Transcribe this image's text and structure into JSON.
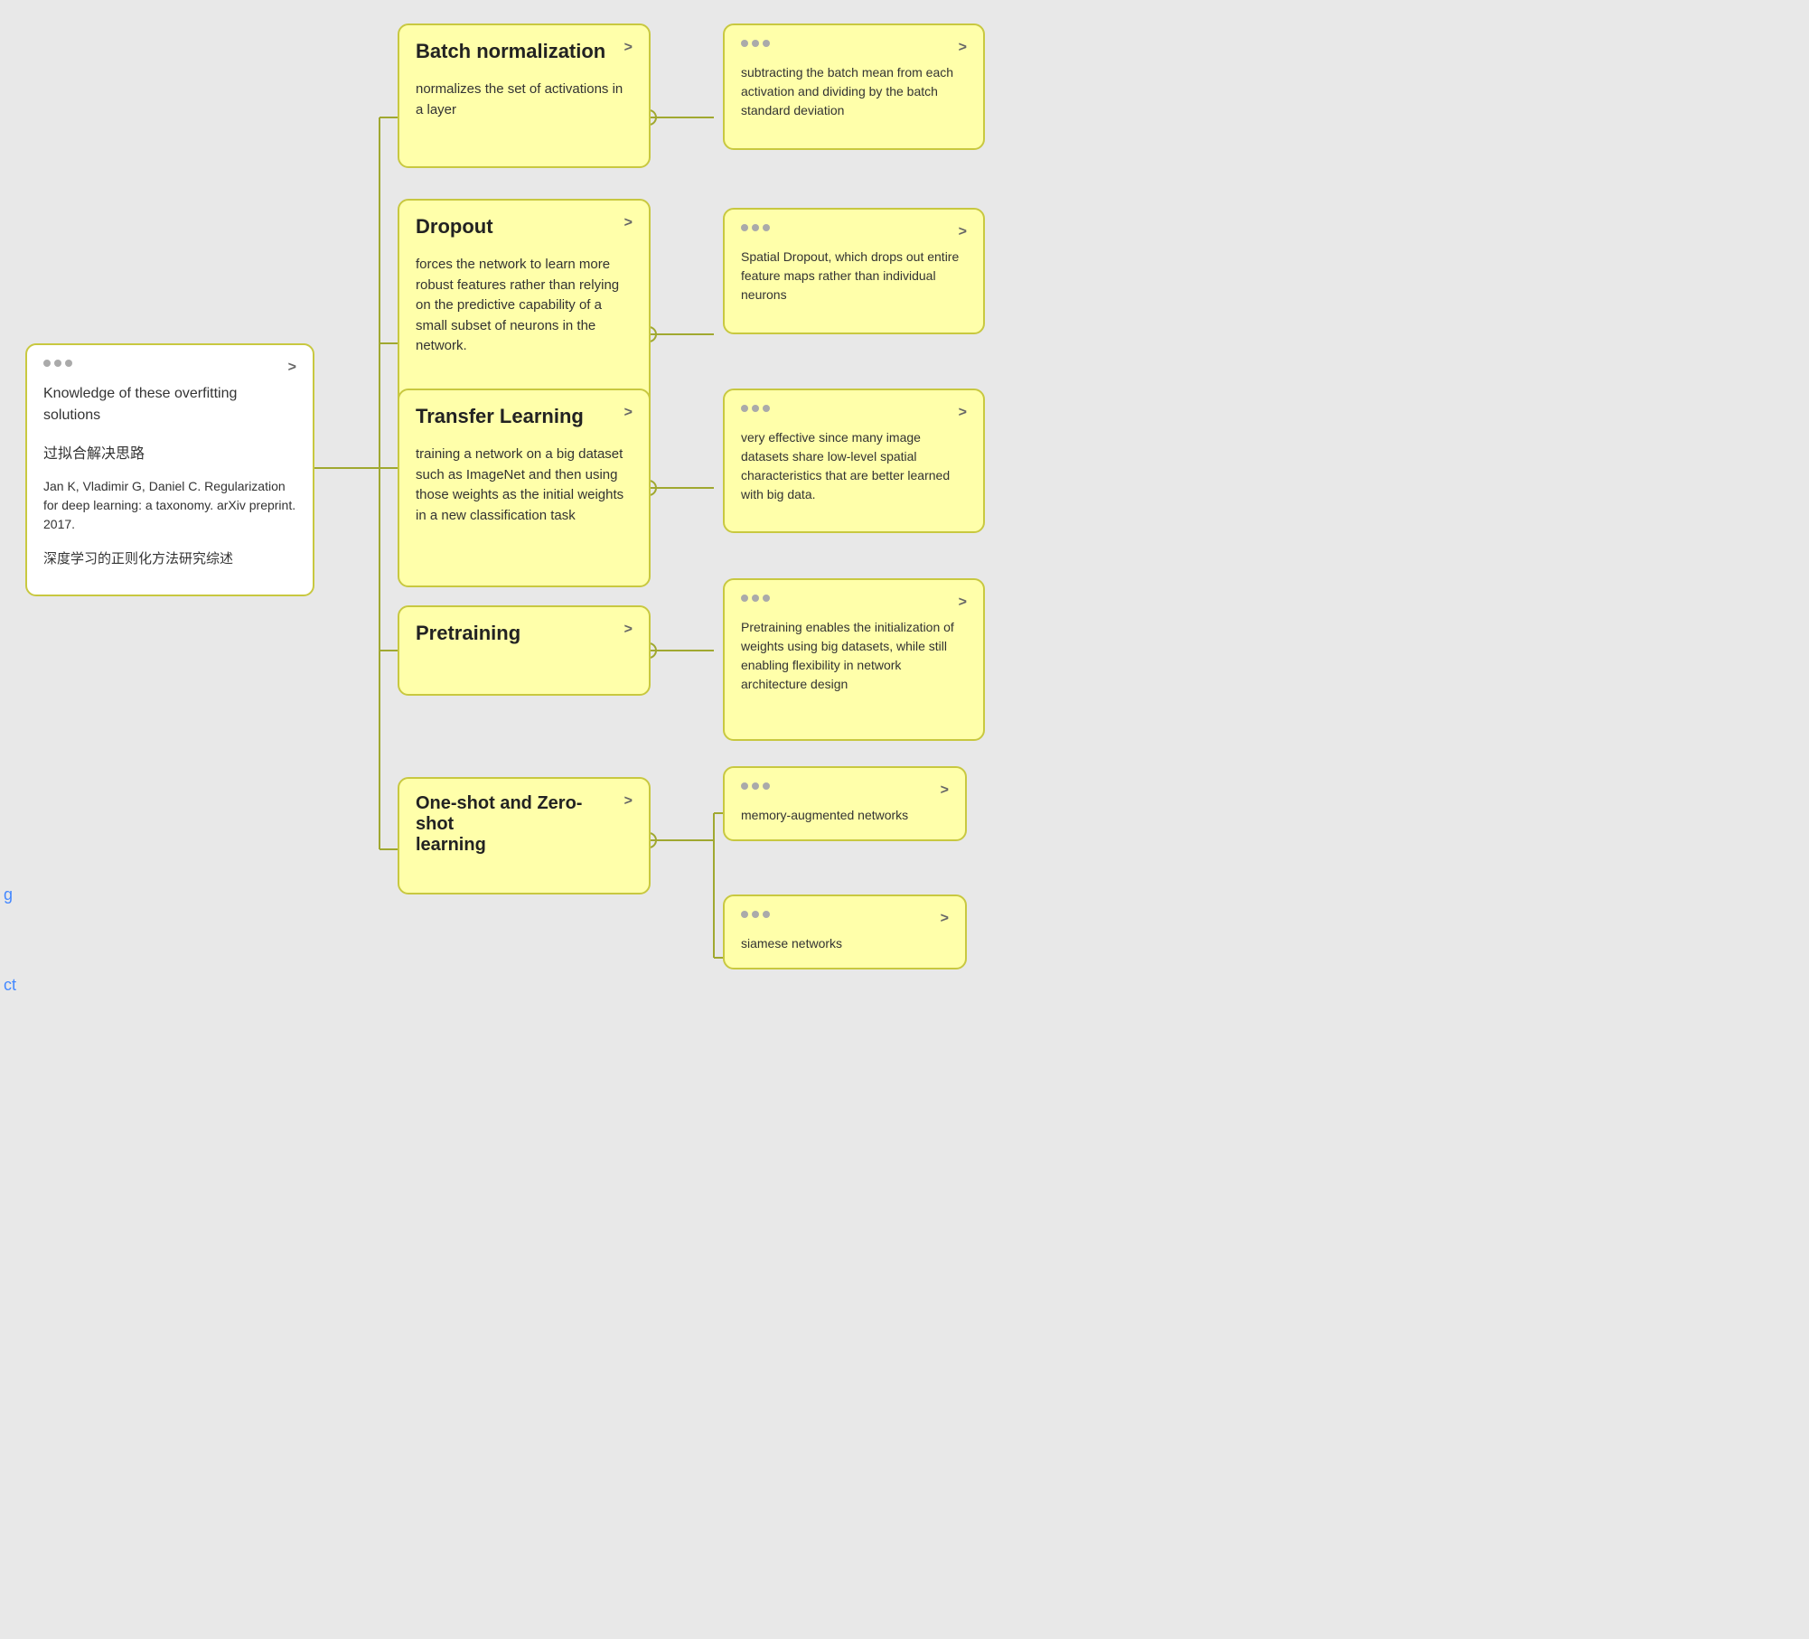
{
  "cards": {
    "root": {
      "title_line1": "Knowledge of these overfitting",
      "title_line2": "solutions",
      "subtitle": "过拟合解决思路",
      "ref": "Jan K, Vladimir G, Daniel C. Regularization for deep learning: a taxonomy. arXiv preprint. 2017.",
      "ref_zh": "深度学习的正则化方法研究综述",
      "arrow": ">"
    },
    "batch_norm": {
      "title": "Batch normalization",
      "text": "normalizes the set of activations in a layer",
      "arrow": ">"
    },
    "dropout": {
      "title": "Dropout",
      "text": "forces the network to learn more robust features rather than relying on the predictive capability of a small subset of neurons in the network.",
      "arrow": ">"
    },
    "transfer_learning": {
      "title": "Transfer Learning",
      "text": "training a network on a big dataset such as ImageNet and then using those weights as the initial weights in a new classification task",
      "arrow": ">"
    },
    "pretraining": {
      "title": "Pretraining",
      "arrow": ">"
    },
    "one_shot": {
      "title_line1": "One-shot and Zero-shot",
      "title_line2": "learning",
      "arrow": ">"
    },
    "batch_norm_detail": {
      "text": "subtracting the batch mean from each activation and dividing by the batch standard deviation",
      "arrow": ">"
    },
    "dropout_detail": {
      "text": "Spatial Dropout, which drops out entire feature maps rather than individual neurons",
      "arrow": ">"
    },
    "transfer_detail": {
      "text": "very effective since many image datasets share low-level spatial characteristics that are better learned with big data.",
      "arrow": ">"
    },
    "pretraining_detail": {
      "text": "Pretraining enables the initialization of weights using big datasets, while still enabling flexibility in network architecture design",
      "arrow": ">"
    },
    "one_shot_detail1": {
      "text": "memory-augmented networks",
      "arrow": ">"
    },
    "one_shot_detail2": {
      "text": "siamese networks",
      "arrow": ">"
    }
  },
  "sidebar": {
    "partial_text": "g",
    "partial_text2": "ct"
  },
  "colors": {
    "yellow_bg": "#ffffaa",
    "yellow_border": "#c8c840",
    "white_bg": "#ffffff",
    "connector": "#a0a830",
    "page_bg": "#e8e8e8"
  }
}
